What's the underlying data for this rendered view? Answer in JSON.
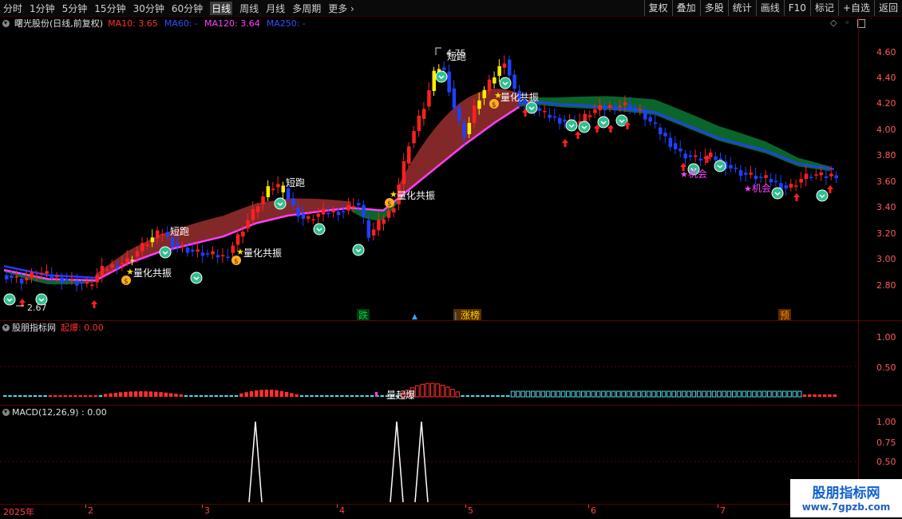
{
  "toolbar": {
    "periods": [
      "分时",
      "1分钟",
      "5分钟",
      "15分钟",
      "30分钟",
      "60分钟",
      "日线",
      "周线",
      "月线",
      "多周期",
      "更多"
    ],
    "active": "日线",
    "right_buttons": [
      "复权",
      "叠加",
      "多股",
      "统计",
      "画线",
      "F10",
      "标记",
      "+自选",
      "返回"
    ]
  },
  "main_chart": {
    "title": "曙光股份(日线,前复权)",
    "ma": [
      {
        "label": "MA10: 3.65",
        "color": "#ff3030"
      },
      {
        "label": "MA60: -",
        "color": "#3050ff"
      },
      {
        "label": "MA120: 3.64",
        "color": "#ff40ff"
      },
      {
        "label": "MA250: -",
        "color": "#3050ff"
      }
    ],
    "price_axis": [
      "4.60",
      "4.40",
      "4.20",
      "4.00",
      "3.80",
      "3.60",
      "3.40",
      "3.20",
      "3.00",
      "2.80"
    ],
    "high_label": "4.75",
    "low_label": "2.67",
    "signals": {
      "short_run": "短跑",
      "co_vibration": "量化共振",
      "opportunity": "机会"
    },
    "bottom_tags": [
      {
        "text": "跌",
        "color": "#00cc44"
      },
      {
        "text": "涨榜",
        "color": "#ffcc00"
      },
      {
        "text": "预",
        "color": "#ff8800"
      }
    ]
  },
  "panel1": {
    "title": "股朋指标网",
    "value_label": "起爆: 0.00",
    "axis": [
      "1.00",
      "0.50"
    ],
    "annotation": "量起爆"
  },
  "panel2": {
    "title": "MACD(12,26,9) : 0.00",
    "axis": [
      "1.00",
      "0.75",
      "0.50"
    ]
  },
  "dates": [
    "2025年",
    "2",
    "3",
    "4",
    "5",
    "6",
    "7"
  ],
  "watermark": {
    "line1": "股朋指标网",
    "line2": "www.7gpzb.com"
  },
  "colors": {
    "up": "#ff2020",
    "down": "#2040ff",
    "warn": "#ffee00",
    "ribbon_up": "#8a2a2a",
    "ribbon_down": "#0c6a2c",
    "ma_pink": "#ff40ff"
  }
}
